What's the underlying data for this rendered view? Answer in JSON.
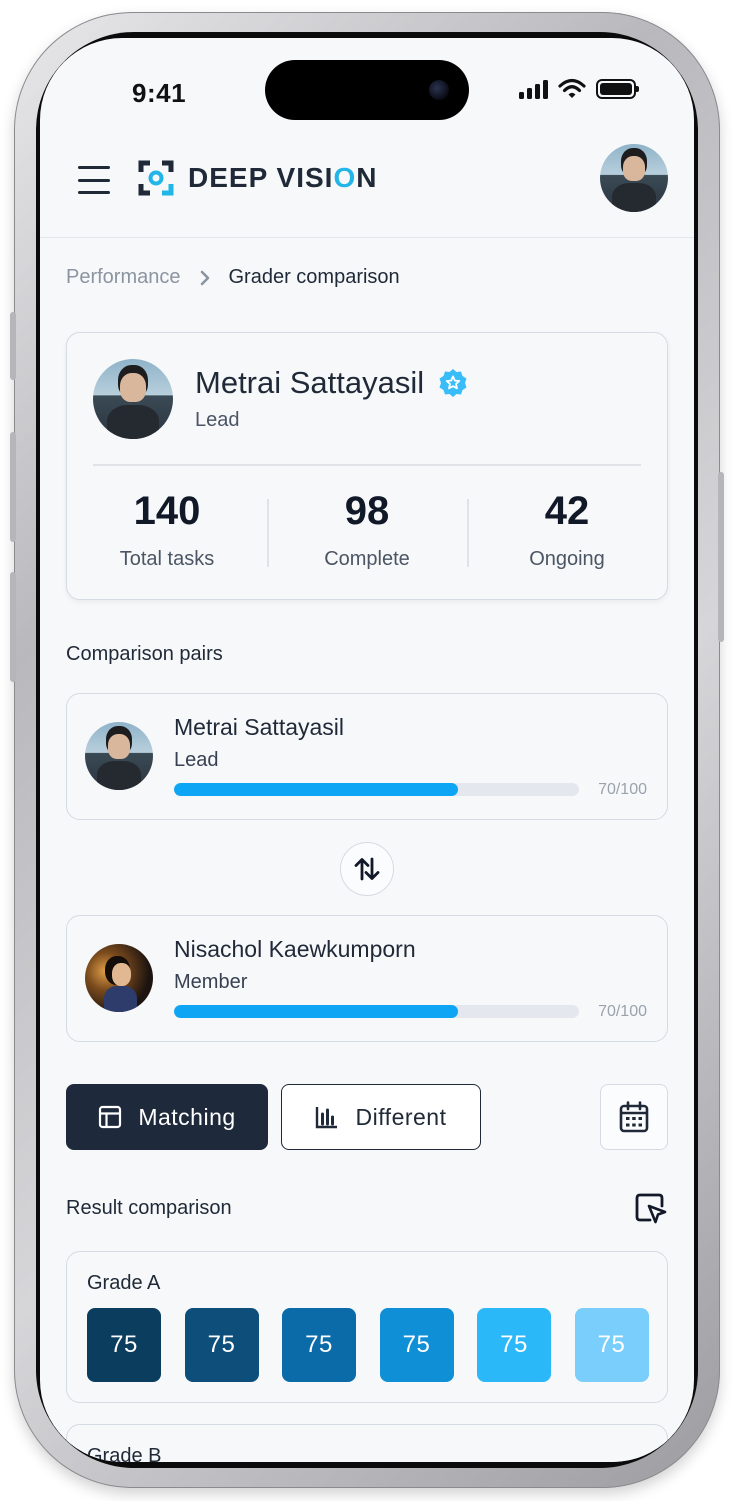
{
  "status_bar": {
    "time": "9:41"
  },
  "header": {
    "brand_prefix": "DEEP VISI",
    "brand_accent": "O",
    "brand_suffix": "N",
    "brand_accent_color": "#22b5e8"
  },
  "breadcrumb": {
    "parent": "Performance",
    "current": "Grader comparison"
  },
  "profile": {
    "name": "Metrai Sattayasil",
    "role": "Lead",
    "verified_icon": "verified-badge-icon",
    "stats": [
      {
        "value": "140",
        "label": "Total tasks"
      },
      {
        "value": "98",
        "label": "Complete"
      },
      {
        "value": "42",
        "label": "Ongoing"
      }
    ]
  },
  "comparison": {
    "title": "Comparison pairs",
    "pairs": [
      {
        "name": "Metrai Sattayasil",
        "role": "Lead",
        "score_text": "70/100",
        "progress": 0.7
      },
      {
        "name": "Nisachol Kaewkumporn",
        "role": "Member",
        "score_text": "70/100",
        "progress": 0.7
      }
    ],
    "swap_icon": "swap-vertical-icon"
  },
  "toggles": {
    "matching_label": "Matching",
    "different_label": "Different",
    "calendar_icon": "calendar-icon"
  },
  "results": {
    "title": "Result comparison",
    "select_icon": "cursor-select-icon",
    "grades": [
      {
        "label": "Grade A",
        "values": [
          "75",
          "75",
          "75",
          "75",
          "75",
          "75"
        ],
        "colors": [
          "#0b3d5f",
          "#0d4f7a",
          "#0b6aa8",
          "#0f8fd6",
          "#2bb8f8",
          "#7acefc"
        ]
      },
      {
        "label": "Grade B"
      }
    ]
  },
  "colors": {
    "primary_dark": "#1e293b",
    "progress": "#0ea5f5",
    "background": "#f7f8fa"
  }
}
